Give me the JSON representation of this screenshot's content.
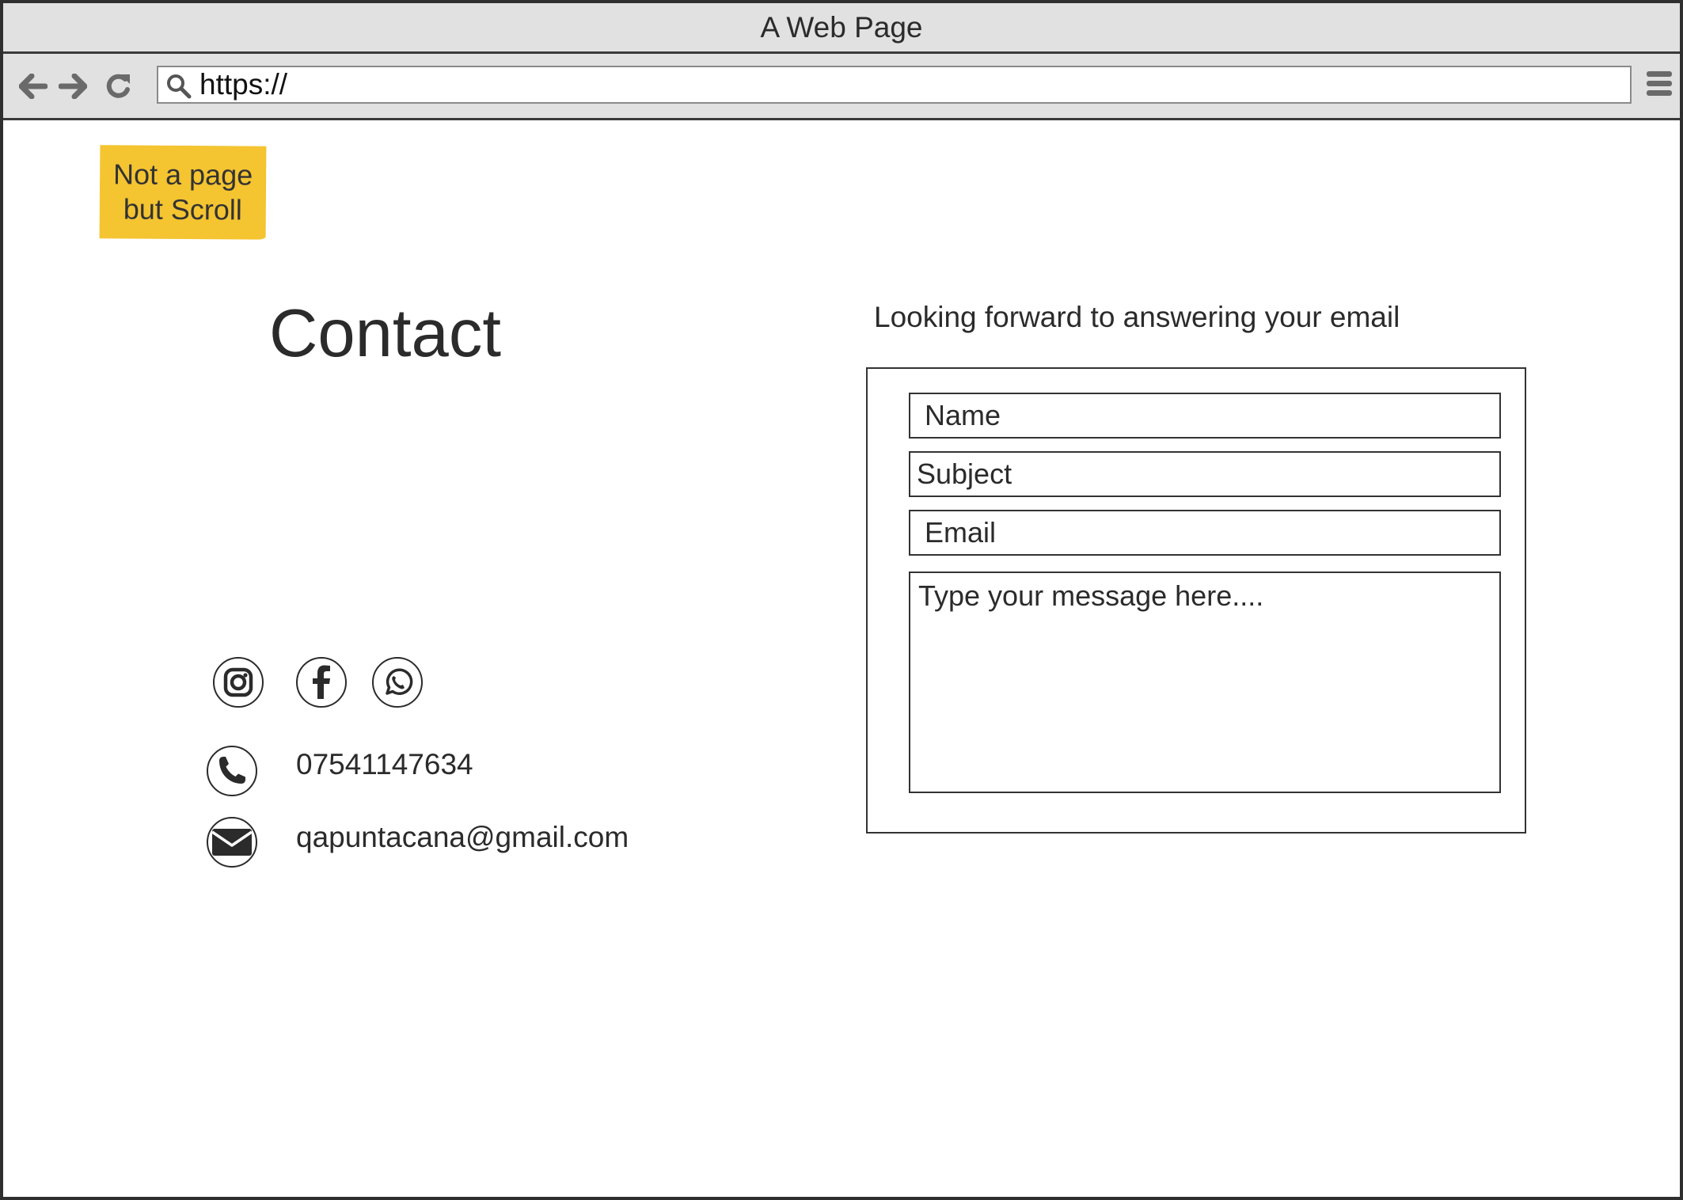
{
  "window": {
    "title": "A Web Page"
  },
  "browser": {
    "url": "https://"
  },
  "note": {
    "line1": "Not a page",
    "line2": "but Scroll"
  },
  "page": {
    "title": "Contact",
    "subtitle": "Looking forward to answering your email"
  },
  "form": {
    "name_placeholder": "Name",
    "subject_placeholder": "Subject",
    "email_placeholder": "Email",
    "message_placeholder": "Type your message here...."
  },
  "contact": {
    "phone": "07541147634",
    "email": "qapuntacana@gmail.com"
  },
  "icons": [
    "back-arrow-icon",
    "forward-arrow-icon",
    "reload-icon",
    "search-icon",
    "hamburger-menu-icon",
    "instagram-icon",
    "facebook-icon",
    "whatsapp-icon",
    "phone-icon",
    "mail-icon"
  ],
  "colors": {
    "note": "#f4c431",
    "chrome": "#e1e1e1",
    "text": "#2b2b2b"
  }
}
